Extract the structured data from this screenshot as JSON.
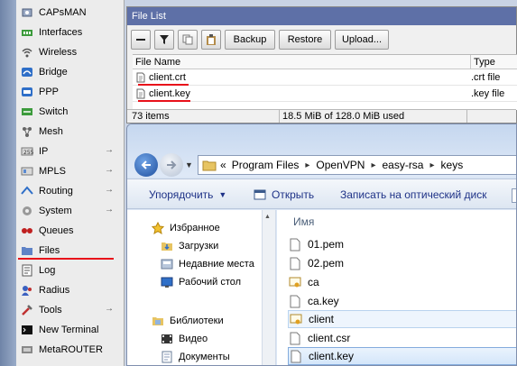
{
  "menu": {
    "items": [
      {
        "label": "CAPsMAN",
        "icon": "capsman-icon",
        "submenu": false
      },
      {
        "label": "Interfaces",
        "icon": "interfaces-icon",
        "submenu": false
      },
      {
        "label": "Wireless",
        "icon": "wireless-icon",
        "submenu": false
      },
      {
        "label": "Bridge",
        "icon": "bridge-icon",
        "submenu": false
      },
      {
        "label": "PPP",
        "icon": "ppp-icon",
        "submenu": false
      },
      {
        "label": "Switch",
        "icon": "switch-icon",
        "submenu": false
      },
      {
        "label": "Mesh",
        "icon": "mesh-icon",
        "submenu": false
      },
      {
        "label": "IP",
        "icon": "ip-icon",
        "submenu": true
      },
      {
        "label": "MPLS",
        "icon": "mpls-icon",
        "submenu": true
      },
      {
        "label": "Routing",
        "icon": "routing-icon",
        "submenu": true
      },
      {
        "label": "System",
        "icon": "system-icon",
        "submenu": true
      },
      {
        "label": "Queues",
        "icon": "queues-icon",
        "submenu": false
      },
      {
        "label": "Files",
        "icon": "files-icon",
        "submenu": false
      },
      {
        "label": "Log",
        "icon": "log-icon",
        "submenu": false
      },
      {
        "label": "Radius",
        "icon": "radius-icon",
        "submenu": false
      },
      {
        "label": "Tools",
        "icon": "tools-icon",
        "submenu": true
      },
      {
        "label": "New Terminal",
        "icon": "terminal-icon",
        "submenu": false
      },
      {
        "label": "MetaROUTER",
        "icon": "metarouter-icon",
        "submenu": false
      }
    ],
    "submenu_arrow": "→"
  },
  "file_list": {
    "title": "File List",
    "toolbar": {
      "backup": "Backup",
      "restore": "Restore",
      "upload": "Upload..."
    },
    "columns": {
      "name": "File Name",
      "type": "Type"
    },
    "rows": [
      {
        "name": "client.crt",
        "type": ".crt file"
      },
      {
        "name": "client.key",
        "type": ".key file"
      }
    ],
    "status": {
      "items": "73 items",
      "usage": "18.5 MiB of 128.0 MiB used"
    }
  },
  "explorer": {
    "address": {
      "prefix": "«",
      "crumbs": [
        "Program Files",
        "OpenVPN",
        "easy-rsa",
        "keys"
      ]
    },
    "commands": {
      "organize": "Упорядочить",
      "open": "Открыть",
      "burn": "Записать на оптический диск"
    },
    "nav": {
      "favorites": "Избранное",
      "downloads": "Загрузки",
      "recent": "Недавние места",
      "desktop": "Рабочий стол",
      "libraries": "Библиотеки",
      "video": "Видео",
      "documents": "Документы"
    },
    "column_name": "Имя",
    "files": [
      {
        "name": "01.pem",
        "icon": "document-icon"
      },
      {
        "name": "02.pem",
        "icon": "document-icon"
      },
      {
        "name": "ca",
        "icon": "certificate-icon"
      },
      {
        "name": "ca.key",
        "icon": "document-icon"
      },
      {
        "name": "client",
        "icon": "certificate-icon"
      },
      {
        "name": "client.csr",
        "icon": "document-icon"
      },
      {
        "name": "client.key",
        "icon": "document-icon"
      }
    ]
  },
  "colors": {
    "highlight_red": "#e8101a",
    "winbox_title": "#5e70a7",
    "menu_strip": "#7c90b2"
  }
}
